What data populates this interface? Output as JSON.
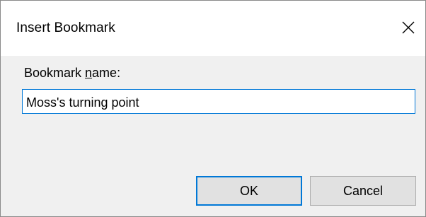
{
  "window": {
    "title": "Insert Bookmark",
    "close_icon": "close-icon"
  },
  "form": {
    "label_prefix": "Bookmark ",
    "label_mnemonic": "n",
    "label_suffix": "ame:",
    "name_value": "Moss's turning point"
  },
  "buttons": {
    "ok_label": "OK",
    "cancel_label": "Cancel"
  },
  "colors": {
    "accent": "#0078d7",
    "dialog_bg": "#f0f0f0",
    "button_bg": "#e1e1e1"
  }
}
